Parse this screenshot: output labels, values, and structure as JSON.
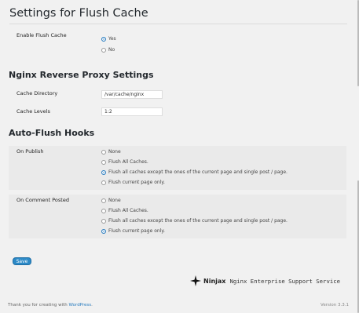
{
  "page_title": "Settings for Flush Cache",
  "enable": {
    "label": "Enable Flush Cache",
    "options": [
      {
        "label": "Yes",
        "checked": true
      },
      {
        "label": "No",
        "checked": false
      }
    ]
  },
  "nginx": {
    "title": "Nginx Reverse Proxy Settings",
    "cache_directory_label": "Cache Directory",
    "cache_directory_value": "/var/cache/nginx",
    "cache_levels_label": "Cache Levels",
    "cache_levels_value": "1:2"
  },
  "hooks": {
    "title": "Auto-Flush Hooks",
    "on_publish": {
      "label": "On Publish",
      "options": [
        {
          "label": "None",
          "checked": false
        },
        {
          "label": "Flush All Caches.",
          "checked": false
        },
        {
          "label": "Flush all caches except the ones of the current page and single post / page.",
          "checked": true
        },
        {
          "label": "Flush current page only.",
          "checked": false
        }
      ]
    },
    "on_comment": {
      "label": "On Comment Posted",
      "options": [
        {
          "label": "None",
          "checked": false
        },
        {
          "label": "Flush All Caches.",
          "checked": false
        },
        {
          "label": "Flush all caches except the ones of the current page and single post / page.",
          "checked": false
        },
        {
          "label": "Flush current page only.",
          "checked": true
        }
      ]
    }
  },
  "save_label": "Save",
  "brand": {
    "name": "Ninjax",
    "tagline": "Nginx Enterprise Support Service",
    "icon": "ninja-star-icon"
  },
  "footer": {
    "thanks_prefix": "Thank you for creating with ",
    "link": "WordPress",
    "thanks_suffix": ".",
    "version": "Version 3.3.1"
  },
  "colors": {
    "accent": "#2a7dc0",
    "row_background": "#eaeaea"
  }
}
